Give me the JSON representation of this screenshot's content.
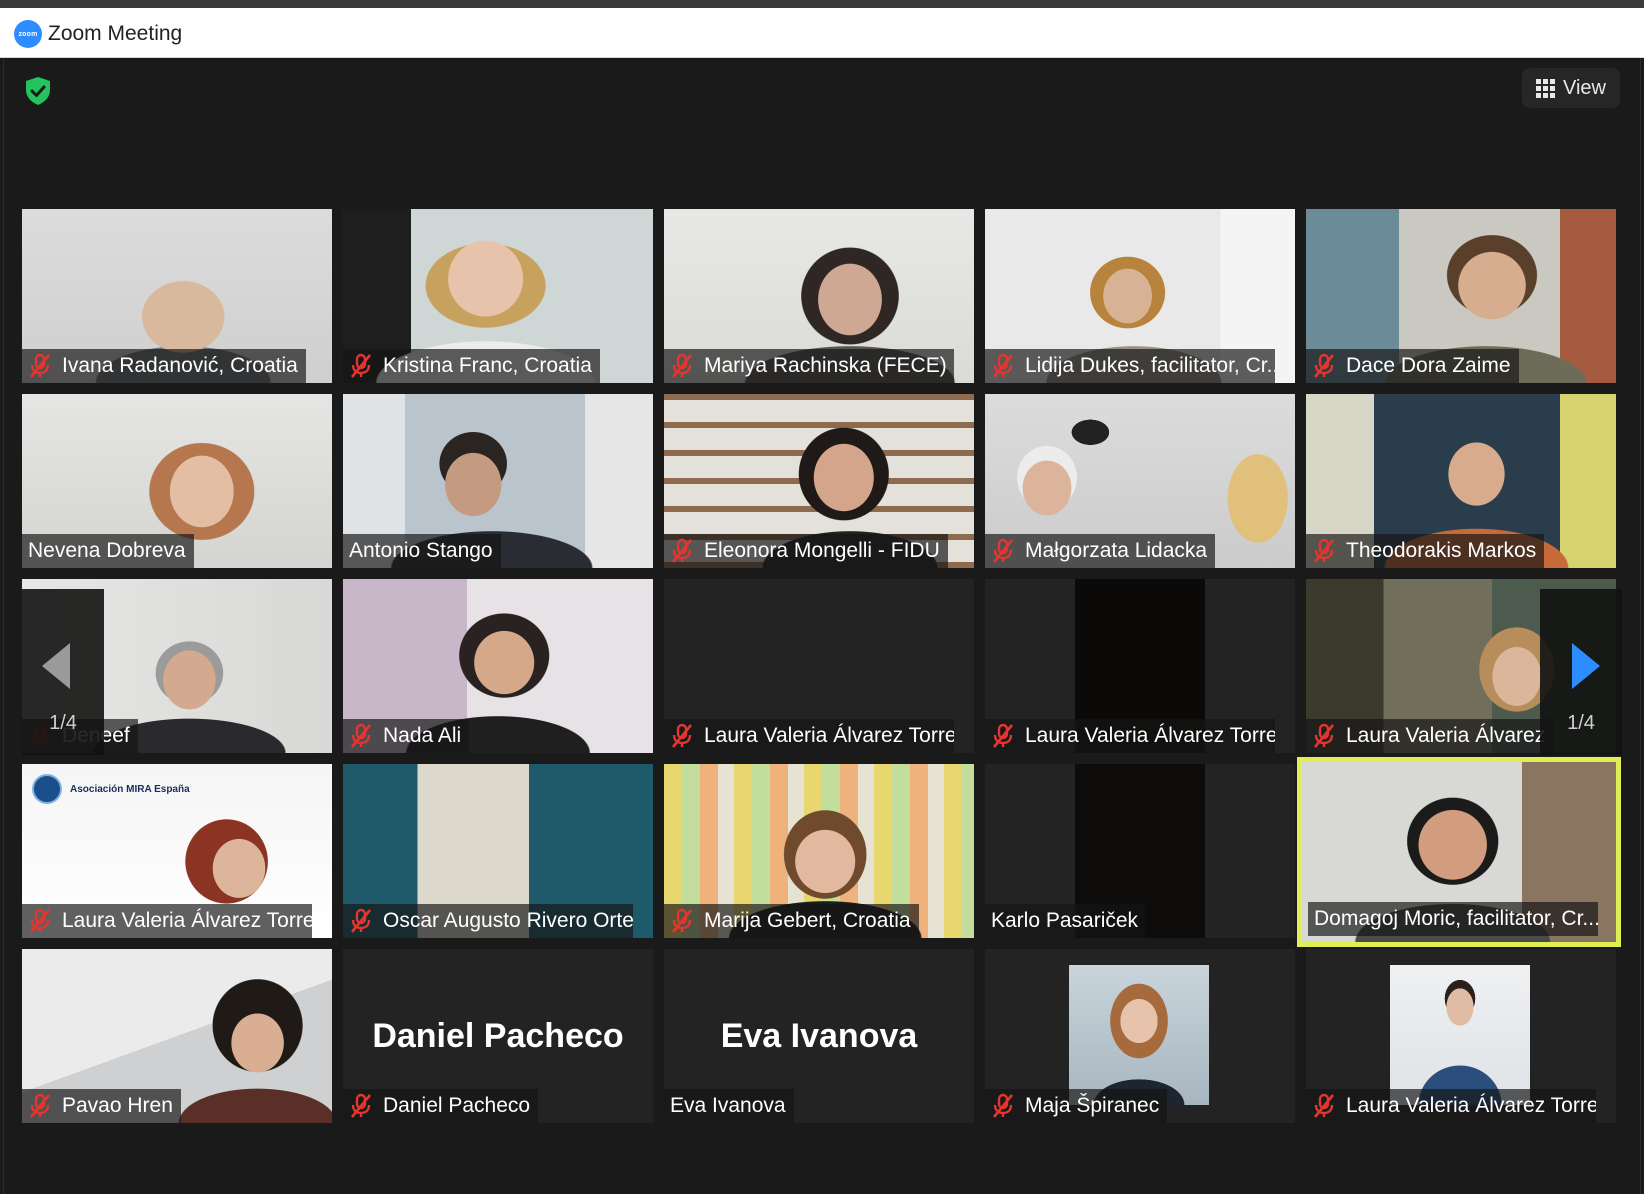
{
  "window": {
    "title": "Zoom Meeting",
    "logo_text": "zoom"
  },
  "toolbar": {
    "view_label": "View",
    "view_icon": "grid-icon",
    "security_icon": "shield-check-icon",
    "security_color": "#23c45e"
  },
  "pager": {
    "left_count": "1/4",
    "right_count": "1/4",
    "right_arrow_color": "#2d8cff",
    "left_arrow_color": "#9a9a9a"
  },
  "participants": [
    {
      "name": "Ivana Radanović, Croatia",
      "muted": true
    },
    {
      "name": "Kristina Franc, Croatia",
      "muted": true
    },
    {
      "name": "Mariya Rachinska (FECE)",
      "muted": true
    },
    {
      "name": "Lidija Dukes, facilitator, Cr...",
      "muted": true
    },
    {
      "name": "Dace Dora Zaime",
      "muted": true
    },
    {
      "name": "Nevena Dobreva",
      "muted": false
    },
    {
      "name": "Antonio Stango",
      "muted": false
    },
    {
      "name": "Eleonora Mongelli - FIDU",
      "muted": true
    },
    {
      "name": "Małgorzata Lidacka",
      "muted": true
    },
    {
      "name": "Theodorakis Markos",
      "muted": true
    },
    {
      "name": "Deneef",
      "muted": true
    },
    {
      "name": "Nada Ali",
      "muted": true
    },
    {
      "name": "Laura Valeria Álvarez Torres",
      "muted": true
    },
    {
      "name": "Laura Valeria Álvarez Torres",
      "muted": true
    },
    {
      "name": "Laura Valeria Álvarez",
      "muted": true
    },
    {
      "name": "Laura Valeria Álvarez Torres",
      "muted": true
    },
    {
      "name": "Oscar Augusto Rivero Orte...",
      "muted": true
    },
    {
      "name": "Marija Gebert, Croatia",
      "muted": true
    },
    {
      "name": "Karlo Pasariček",
      "muted": false
    },
    {
      "name": "Domagoj Moric, facilitator, Cr...",
      "muted": false,
      "active_speaker": true
    },
    {
      "name": "Pavao Hren",
      "muted": true
    },
    {
      "name": "Daniel Pacheco",
      "muted": true,
      "big_name": "Daniel Pacheco"
    },
    {
      "name": "Eva Ivanova",
      "muted": false,
      "big_name": "Eva Ivanova"
    },
    {
      "name": "Maja Špiranec",
      "muted": true
    },
    {
      "name": "Laura Valeria Álvarez Torres",
      "muted": true
    }
  ],
  "tile_overlay": {
    "logo_text": "Asociación MIRA España"
  }
}
